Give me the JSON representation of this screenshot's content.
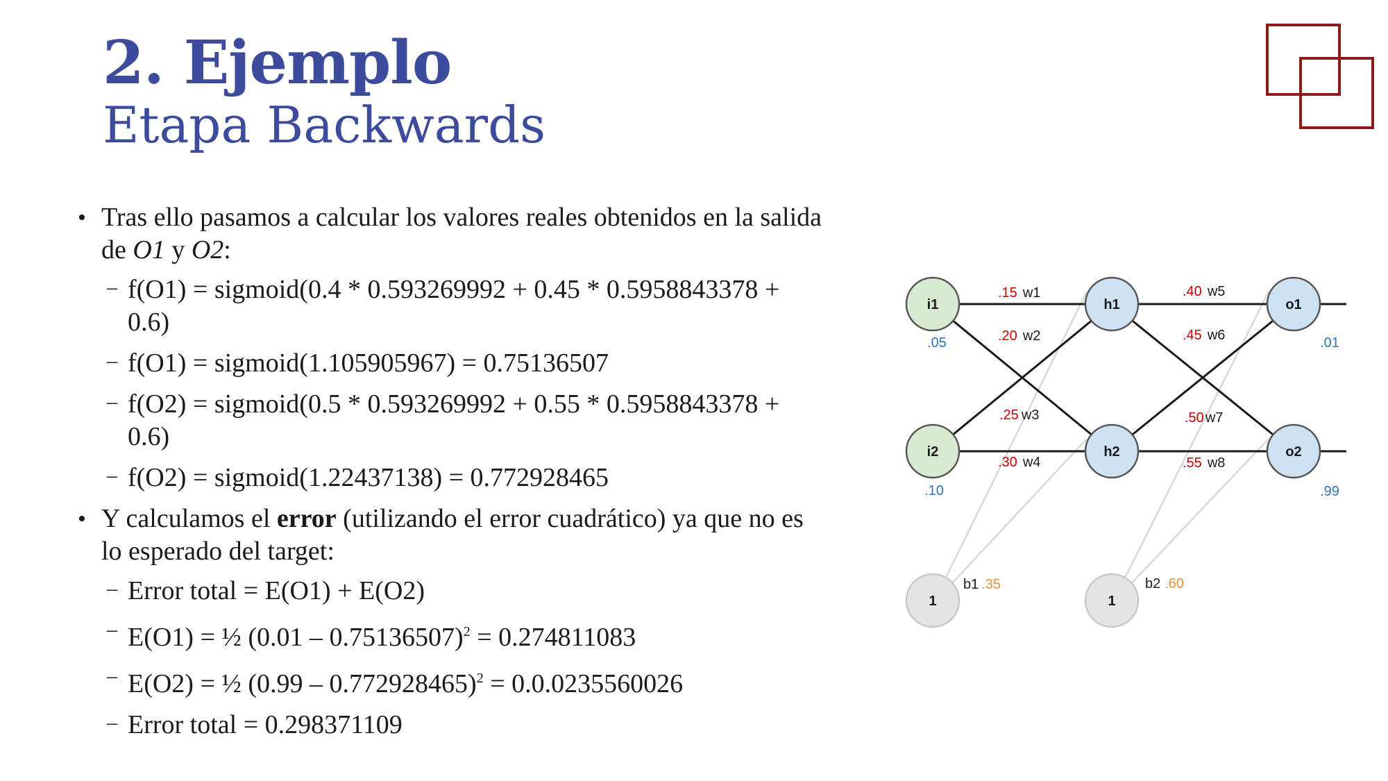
{
  "title": "2. Ejemplo",
  "subtitle": "Etapa Backwards",
  "bullet1": {
    "text1": "Tras ello pasamos a calcular los valores reales obtenidos en la salida de ",
    "o1": "O1",
    "text2": " y ",
    "o2": "O2",
    "text3": ":"
  },
  "sub1": [
    "f(O1) = sigmoid(0.4 * 0.593269992 + 0.45 * 0.5958843378 + 0.6)",
    "f(O1) = sigmoid(1.105905967) = 0.75136507",
    "f(O2) = sigmoid(0.5 * 0.593269992 + 0.55 * 0.5958843378 + 0.6)",
    "f(O2) = sigmoid(1.22437138) = 0.772928465"
  ],
  "bullet2": {
    "text1": "Y calculamos el ",
    "bold": "error",
    "text2": " (utilizando el error cuadrático) ya que no es lo esperado del target:"
  },
  "sub2": {
    "line1": "Error total = E(O1) + E(O2)",
    "line2_a": "E(O1) = ½ (0.01 – 0.75136507)",
    "line2_sup": "2",
    "line2_b": " = 0.274811083",
    "line3_a": "E(O2) = ½ (0.99 – 0.772928465)",
    "line3_sup": "2",
    "line3_b": " = 0.0.0235560026",
    "line4": "Error total = 0.298371109"
  },
  "network": {
    "nodes": {
      "i1": "i1",
      "i2": "i2",
      "h1": "h1",
      "h2": "h2",
      "o1": "o1",
      "o2": "o2",
      "b1": "1",
      "b2": "1"
    },
    "inputs": {
      "i1": ".05",
      "i2": ".10"
    },
    "targets": {
      "o1": ".01",
      "o2": ".99"
    },
    "weights": [
      {
        "value": ".15",
        "name": "w1"
      },
      {
        "value": ".20",
        "name": "w2"
      },
      {
        "value": ".25",
        "name": "w3"
      },
      {
        "value": ".30",
        "name": "w4"
      },
      {
        "value": ".40",
        "name": "w5"
      },
      {
        "value": ".45",
        "name": "w6"
      },
      {
        "value": ".50",
        "name": "w7"
      },
      {
        "value": ".55",
        "name": "w8"
      }
    ],
    "biases": [
      {
        "name": "b1",
        "value": ".35"
      },
      {
        "name": "b2",
        "value": ".60"
      }
    ]
  },
  "colors": {
    "title": "#3d4b9c",
    "logo": "#8b1a1a",
    "input_node": "#d9ead3",
    "hidden_node": "#cfe2f3",
    "bias_node": "#e5e5e5",
    "weight": "#cc0000",
    "input_value": "#2e75b6",
    "bias_value": "#e69138"
  }
}
